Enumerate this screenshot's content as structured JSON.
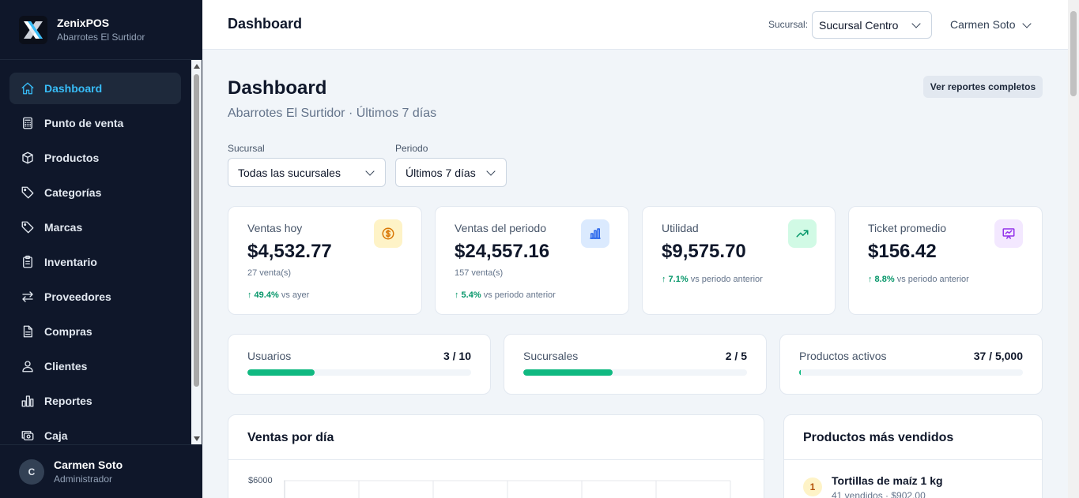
{
  "brand": {
    "name": "ZenixPOS",
    "store": "Abarrotes El Surtidor"
  },
  "sidebar": {
    "items": [
      {
        "label": "Dashboard",
        "icon": "home-icon",
        "active": true
      },
      {
        "label": "Punto de venta",
        "icon": "calculator-icon"
      },
      {
        "label": "Productos",
        "icon": "box-icon"
      },
      {
        "label": "Categorías",
        "icon": "tag-icon"
      },
      {
        "label": "Marcas",
        "icon": "tag-icon"
      },
      {
        "label": "Inventario",
        "icon": "clipboard-icon"
      },
      {
        "label": "Proveedores",
        "icon": "arrows-icon"
      },
      {
        "label": "Compras",
        "icon": "document-icon"
      },
      {
        "label": "Clientes",
        "icon": "users-icon"
      },
      {
        "label": "Reportes",
        "icon": "bar-chart-icon"
      },
      {
        "label": "Caja",
        "icon": "cash-icon"
      }
    ],
    "user": {
      "initial": "C",
      "name": "Carmen Soto",
      "role": "Administrador"
    }
  },
  "topbar": {
    "title": "Dashboard",
    "branch_label": "Sucursal:",
    "branch_value": "Sucursal Centro",
    "user_name": "Carmen Soto"
  },
  "header": {
    "title": "Dashboard",
    "subtitle": "Abarrotes El Surtidor · Últimos 7 días",
    "report_button": "Ver reportes completos"
  },
  "filters": {
    "branch": {
      "label": "Sucursal",
      "value": "Todas las sucursales"
    },
    "period": {
      "label": "Periodo",
      "value": "Últimos 7 días"
    }
  },
  "kpis": [
    {
      "label": "Ventas hoy",
      "value": "$4,532.77",
      "note": "27 venta(s)",
      "trend": "↑ 49.4%",
      "trend_text": "vs ayer",
      "icon": "dollar-icon",
      "icon_bg": "#fef3c7",
      "icon_color": "#d97706"
    },
    {
      "label": "Ventas del periodo",
      "value": "$24,557.16",
      "note": "157 venta(s)",
      "trend": "↑ 5.4%",
      "trend_text": "vs periodo anterior",
      "icon": "bar-chart-icon",
      "icon_bg": "#dbeafe",
      "icon_color": "#2563eb"
    },
    {
      "label": "Utilidad",
      "value": "$9,575.70",
      "note": "",
      "trend": "↑ 7.1%",
      "trend_text": "vs periodo anterior",
      "icon": "trending-up-icon",
      "icon_bg": "#d1fae5",
      "icon_color": "#059669"
    },
    {
      "label": "Ticket promedio",
      "value": "$156.42",
      "note": "",
      "trend": "↑ 8.8%",
      "trend_text": "vs periodo anterior",
      "icon": "presentation-icon",
      "icon_bg": "#f3e8ff",
      "icon_color": "#9333ea"
    }
  ],
  "usage": [
    {
      "label": "Usuarios",
      "count": "3 / 10",
      "fraction": 0.3
    },
    {
      "label": "Sucursales",
      "count": "2 / 5",
      "fraction": 0.4
    },
    {
      "label": "Productos activos",
      "count": "37 / 5,000",
      "fraction": 0.0074
    }
  ],
  "sales_chart": {
    "title": "Ventas por día",
    "y_tick_top": "$6000"
  },
  "top_products": {
    "title": "Productos más vendidos",
    "items": [
      {
        "rank": "1",
        "name": "Tortillas de maíz 1 kg",
        "meta": "41 vendidos · $902.00"
      }
    ]
  },
  "colors": {
    "accent": "#38bdf8",
    "progress": "#10b981",
    "sidebar_bg": "#0f172a",
    "trend_up": "#059669"
  }
}
